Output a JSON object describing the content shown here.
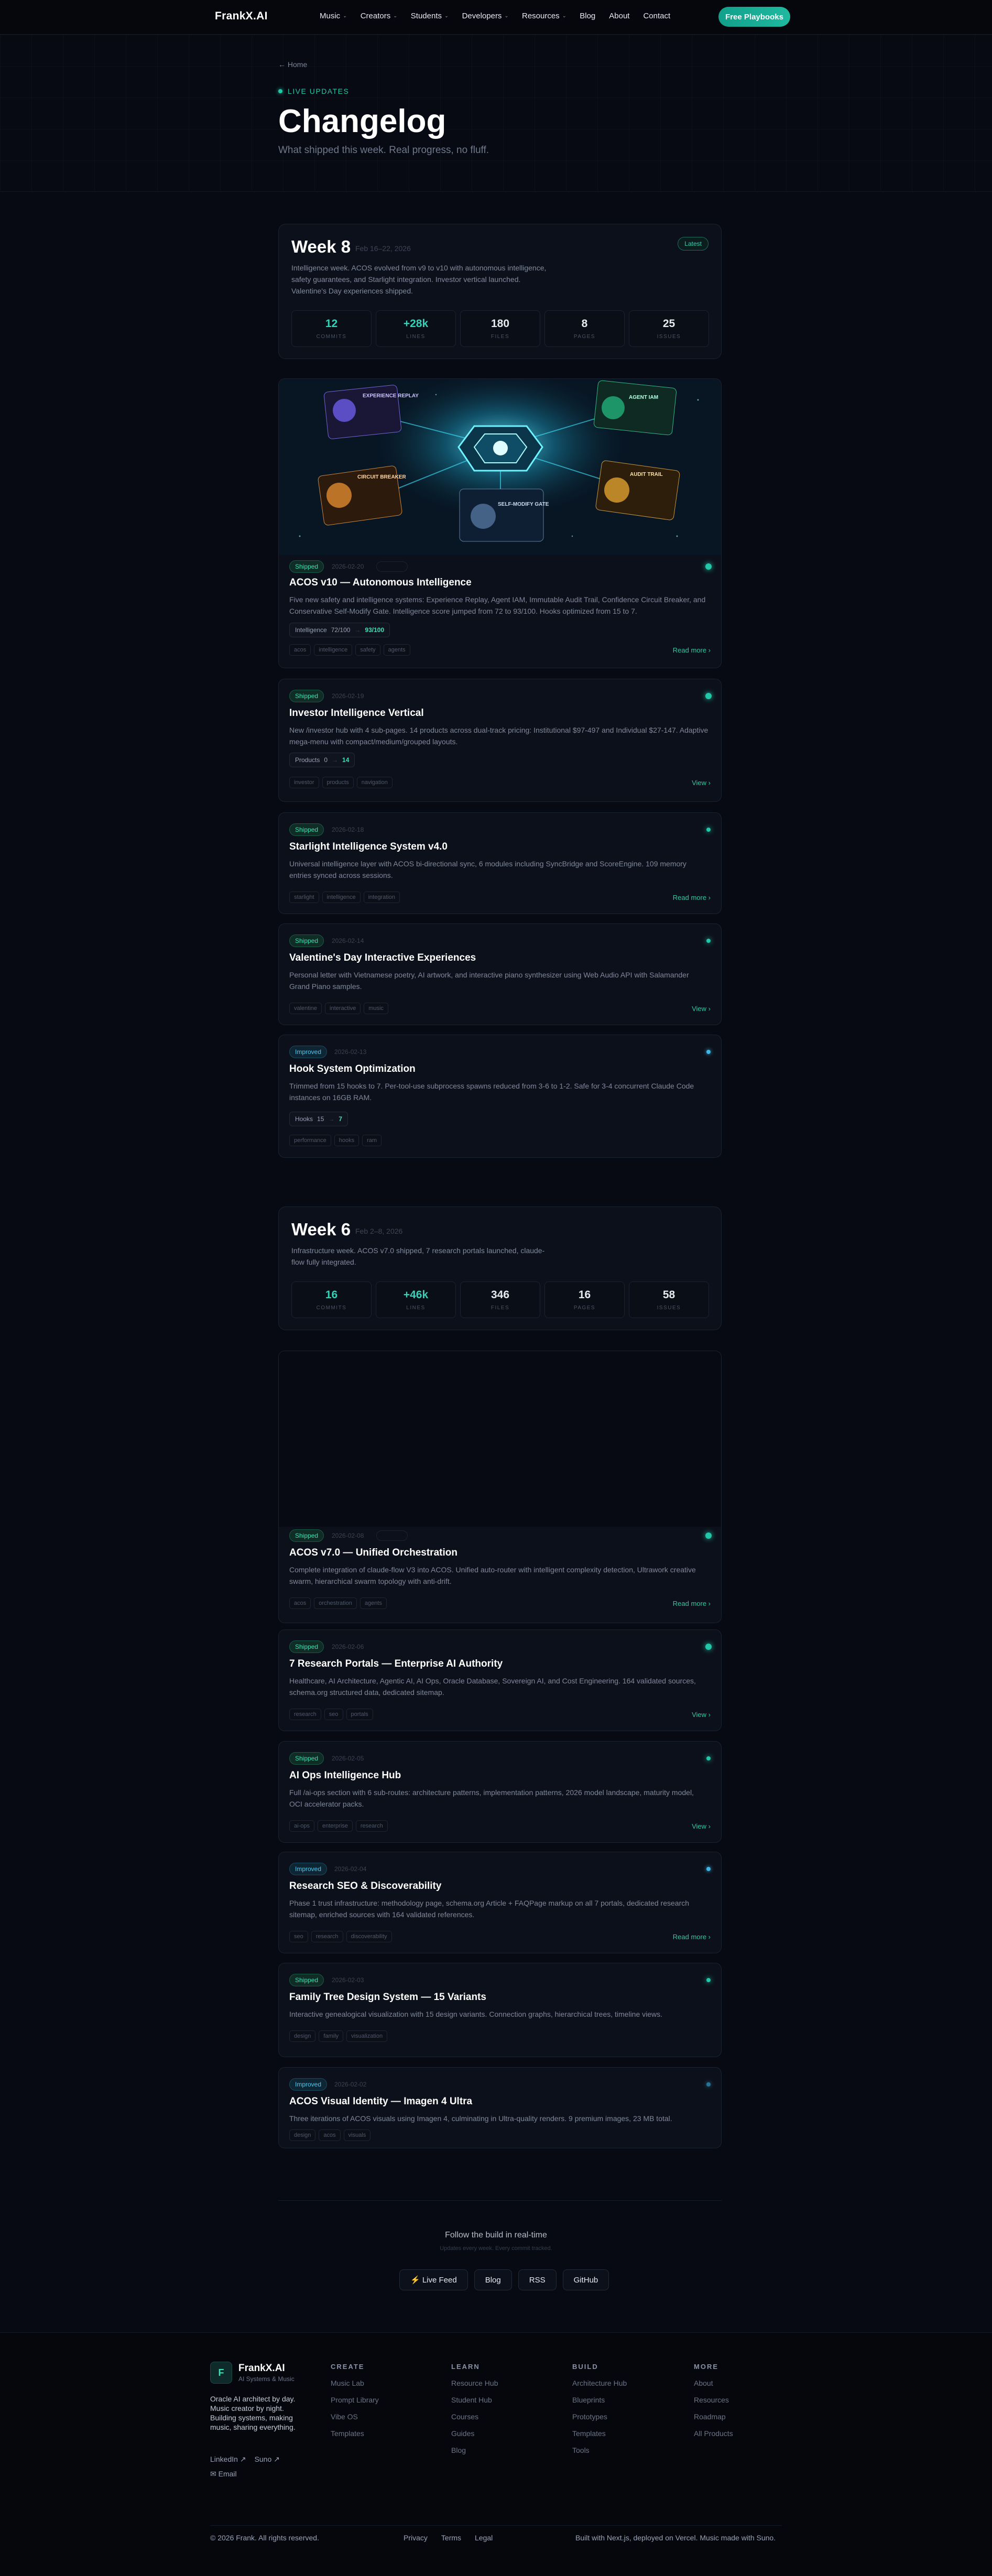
{
  "brand": {
    "logo": "FrankX.AI",
    "cta": "Free Playbooks"
  },
  "nav": [
    {
      "label": "Music",
      "dd": true
    },
    {
      "label": "Creators",
      "dd": true
    },
    {
      "label": "Students",
      "dd": true
    },
    {
      "label": "Developers",
      "dd": true
    },
    {
      "label": "Resources",
      "dd": true
    },
    {
      "label": "Blog",
      "dd": false
    },
    {
      "label": "About",
      "dd": false
    },
    {
      "label": "Contact",
      "dd": false
    }
  ],
  "hero": {
    "breadcrumb": "← Home",
    "live": "LIVE UPDATES",
    "title": "Changelog",
    "subtitle": "What shipped this week. Real progress, no fluff."
  },
  "weeks": [
    {
      "title": "Week 8",
      "range": "Feb 16–22, 2026",
      "desc": "Intelligence week. ACOS evolved from v9 to v10 with autonomous intelligence, safety guarantees, and Starlight integration. Investor vertical launched. Valentine's Day experiences shipped.",
      "badge": "Latest",
      "stats": [
        {
          "v": "12",
          "l": "COMMITS",
          "t": true
        },
        {
          "v": "+28k",
          "l": "LINES",
          "t": true
        },
        {
          "v": "180",
          "l": "FILES",
          "t": false
        },
        {
          "v": "8",
          "l": "PAGES",
          "t": false
        },
        {
          "v": "25",
          "l": "ISSUES",
          "t": false
        }
      ]
    },
    {
      "title": "Week 6",
      "range": "Feb 2–8, 2026",
      "desc": "Infrastructure week. ACOS v7.0 shipped, 7 research portals launched, claude-flow fully integrated.",
      "badge": "",
      "stats": [
        {
          "v": "16",
          "l": "COMMITS",
          "t": true
        },
        {
          "v": "+46k",
          "l": "LINES",
          "t": true
        },
        {
          "v": "346",
          "l": "FILES",
          "t": false
        },
        {
          "v": "16",
          "l": "PAGES",
          "t": false
        },
        {
          "v": "58",
          "l": "ISSUES",
          "t": false
        }
      ]
    }
  ],
  "art": {
    "panels": [
      "EXPERIENCE REPLAY",
      "AGENT IAM",
      "CIRCUIT BREAKER",
      "AUDIT TRAIL",
      "SELF-MODIFY GATE"
    ]
  },
  "entries": [
    {
      "status": "Shipped",
      "date": "2026-02-20",
      "title": "ACOS v10 — Autonomous Intelligence",
      "desc": "Five new safety and intelligence systems: Experience Replay, Agent IAM, Immutable Audit Trail, Confidence Circuit Breaker, and Conservative Self-Modify Gate. Intelligence score jumped from 72 to 93/100. Hooks optimized from 15 to 7.",
      "metric": {
        "label": "Intelligence",
        "old": "72/100",
        "new": "93/100"
      },
      "tags": [
        "acos",
        "intelligence",
        "safety",
        "agents"
      ],
      "link": "Read more ›"
    },
    {
      "status": "Shipped",
      "date": "2026-02-19",
      "title": "Investor Intelligence Vertical",
      "desc": "New /investor hub with 4 sub-pages. 14 products across dual-track pricing: Institutional $97-497 and Individual $27-147. Adaptive mega-menu with compact/medium/grouped layouts.",
      "metric": {
        "label": "Products",
        "old": "0",
        "new": "14"
      },
      "tags": [
        "investor",
        "products",
        "navigation"
      ],
      "link": "View ›"
    },
    {
      "status": "Shipped",
      "date": "2026-02-18",
      "title": "Starlight Intelligence System v4.0",
      "desc": "Universal intelligence layer with ACOS bi-directional sync, 6 modules including SyncBridge and ScoreEngine. 109 memory entries synced across sessions.",
      "tags": [
        "starlight",
        "intelligence",
        "integration"
      ],
      "link": "Read more ›"
    },
    {
      "status": "Shipped",
      "date": "2026-02-14",
      "title": "Valentine's Day Interactive Experiences",
      "desc": "Personal letter with Vietnamese poetry, AI artwork, and interactive piano synthesizer using Web Audio API with Salamander Grand Piano samples.",
      "tags": [
        "valentine",
        "interactive",
        "music"
      ],
      "link": "View ›"
    },
    {
      "status": "Improved",
      "date": "2026-02-13",
      "title": "Hook System Optimization",
      "desc": "Trimmed from 15 hooks to 7. Per-tool-use subprocess spawns reduced from 3-6 to 1-2. Safe for 3-4 concurrent Claude Code instances on 16GB RAM.",
      "metric": {
        "label": "Hooks",
        "old": "15",
        "new": "7"
      },
      "tags": [
        "performance",
        "hooks",
        "ram"
      ],
      "link": ""
    },
    {
      "status": "Shipped",
      "date": "2026-02-08",
      "title": "ACOS v7.0 — Unified Orchestration",
      "desc": "Complete integration of claude-flow V3 into ACOS. Unified auto-router with intelligent complexity detection, Ultrawork creative swarm, hierarchical swarm topology with anti-drift.",
      "tags": [
        "acos",
        "orchestration",
        "agents"
      ],
      "link": "Read more ›"
    },
    {
      "status": "Shipped",
      "date": "2026-02-06",
      "title": "7 Research Portals — Enterprise AI Authority",
      "desc": "Healthcare, AI Architecture, Agentic AI, AI Ops, Oracle Database, Sovereign AI, and Cost Engineering. 164 validated sources, schema.org structured data, dedicated sitemap.",
      "tags": [
        "research",
        "seo",
        "portals"
      ],
      "link": "View ›"
    },
    {
      "status": "Shipped",
      "date": "2026-02-05",
      "title": "AI Ops Intelligence Hub",
      "desc": "Full /ai-ops section with 6 sub-routes: architecture patterns, implementation patterns, 2026 model landscape, maturity model, OCI accelerator packs.",
      "tags": [
        "ai-ops",
        "enterprise",
        "research"
      ],
      "link": "View ›"
    },
    {
      "status": "Improved",
      "date": "2026-02-04",
      "title": "Research SEO & Discoverability",
      "desc": "Phase 1 trust infrastructure: methodology page, schema.org Article + FAQPage markup on all 7 portals, dedicated research sitemap, enriched sources with 164 validated references.",
      "tags": [
        "seo",
        "research",
        "discoverability"
      ],
      "link": "Read more ›"
    },
    {
      "status": "Shipped",
      "date": "2026-02-03",
      "title": "Family Tree Design System — 15 Variants",
      "desc": "Interactive genealogical visualization with 15 design variants. Connection graphs, hierarchical trees, timeline views.",
      "tags": [
        "design",
        "family",
        "visualization"
      ],
      "link": ""
    },
    {
      "status": "Improved",
      "date": "2026-02-02",
      "title": "ACOS Visual Identity — Imagen 4 Ultra",
      "desc": "Three iterations of ACOS visuals using Imagen 4, culminating in Ultra-quality renders. 9 premium images, 23 MB total.",
      "tags": [
        "design",
        "acos",
        "visuals"
      ],
      "link": ""
    }
  ],
  "follow": {
    "title": "Follow the build in real-time",
    "sub": "Updates every week. Every commit tracked.",
    "buttons": [
      "⚡ Live Feed",
      "Blog",
      "RSS",
      "GitHub"
    ]
  },
  "footer": {
    "brand": "FrankX.AI",
    "tagline": "AI Systems & Music",
    "blurb": "Oracle AI architect by day. Music creator by night. Building systems, making music, sharing everything.",
    "social": [
      "LinkedIn ↗",
      "Suno ↗",
      "✉ Email"
    ],
    "cols": [
      {
        "title": "CREATE",
        "items": [
          "Music Lab",
          "Prompt Library",
          "Vibe OS",
          "Templates"
        ]
      },
      {
        "title": "LEARN",
        "items": [
          "Resource Hub",
          "Student Hub",
          "Courses",
          "Guides",
          "Blog"
        ]
      },
      {
        "title": "BUILD",
        "items": [
          "Architecture Hub",
          "Blueprints",
          "Prototypes",
          "Templates",
          "Tools"
        ]
      },
      {
        "title": "MORE",
        "items": [
          "About",
          "Resources",
          "Roadmap",
          "All Products"
        ]
      }
    ],
    "copyright": "© 2026 Frank. All rights reserved.",
    "legal": [
      "Privacy",
      "Terms",
      "Legal"
    ],
    "built": "Built with Next.js, deployed on Vercel. Music made with Suno."
  }
}
